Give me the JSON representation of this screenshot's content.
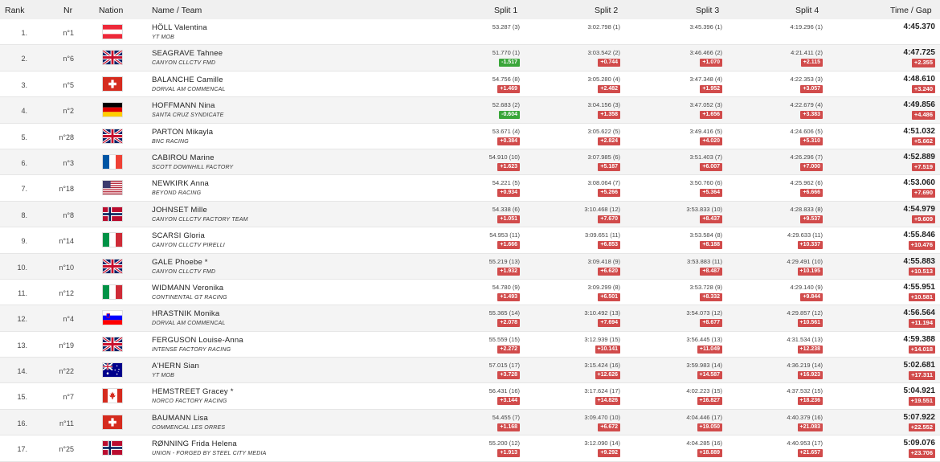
{
  "headers": {
    "rank": "Rank",
    "nr": "Nr",
    "nation": "Nation",
    "name_team": "Name / Team",
    "split1": "Split 1",
    "split2": "Split 2",
    "split3": "Split 3",
    "split4": "Split 4",
    "time_gap": "Time / Gap"
  },
  "rows": [
    {
      "rank": "1.",
      "nr": "n°1",
      "flag": "AUT",
      "name": "HÖLL Valentina",
      "team": "YT MOB",
      "s1": "53.287 (3)",
      "s1g": "",
      "s2": "3:02.798 (1)",
      "s2g": "",
      "s3": "3:45.396 (1)",
      "s3g": "",
      "s4": "4:19.296 (1)",
      "s4g": "",
      "time": "4:45.370",
      "gap": ""
    },
    {
      "rank": "2.",
      "nr": "n°6",
      "flag": "GBR",
      "name": "SEAGRAVE Tahnee",
      "team": "CANYON CLLCTV FMD",
      "s1": "51.770 (1)",
      "s1g": "-1.517",
      "s2": "3:03.542 (2)",
      "s2g": "+0.744",
      "s3": "3:46.466 (2)",
      "s3g": "+1.070",
      "s4": "4:21.411 (2)",
      "s4g": "+2.115",
      "time": "4:47.725",
      "gap": "+2.355"
    },
    {
      "rank": "3.",
      "nr": "n°5",
      "flag": "SUI",
      "name": "BALANCHE Camille",
      "team": "DORVAL AM COMMENCAL",
      "s1": "54.756 (8)",
      "s1g": "+1.469",
      "s2": "3:05.280 (4)",
      "s2g": "+2.482",
      "s3": "3:47.348 (4)",
      "s3g": "+1.952",
      "s4": "4:22.353 (3)",
      "s4g": "+3.057",
      "time": "4:48.610",
      "gap": "+3.240"
    },
    {
      "rank": "4.",
      "nr": "n°2",
      "flag": "GER",
      "name": "HOFFMANN Nina",
      "team": "SANTA CRUZ SYNDICATE",
      "s1": "52.683 (2)",
      "s1g": "-0.604",
      "s2": "3:04.156 (3)",
      "s2g": "+1.358",
      "s3": "3:47.052 (3)",
      "s3g": "+1.656",
      "s4": "4:22.679 (4)",
      "s4g": "+3.383",
      "time": "4:49.856",
      "gap": "+4.486"
    },
    {
      "rank": "5.",
      "nr": "n°28",
      "flag": "GBR",
      "name": "PARTON Mikayla",
      "team": "BNC RACING",
      "s1": "53.671 (4)",
      "s1g": "+0.384",
      "s2": "3:05.622 (5)",
      "s2g": "+2.824",
      "s3": "3:49.416 (5)",
      "s3g": "+4.020",
      "s4": "4:24.606 (5)",
      "s4g": "+5.310",
      "time": "4:51.032",
      "gap": "+5.662"
    },
    {
      "rank": "6.",
      "nr": "n°3",
      "flag": "FRA",
      "name": "CABIROU Marine",
      "team": "SCOTT DOWNHILL FACTORY",
      "s1": "54.910 (10)",
      "s1g": "+1.623",
      "s2": "3:07.985 (6)",
      "s2g": "+5.187",
      "s3": "3:51.403 (7)",
      "s3g": "+6.007",
      "s4": "4:26.296 (7)",
      "s4g": "+7.000",
      "time": "4:52.889",
      "gap": "+7.519"
    },
    {
      "rank": "7.",
      "nr": "n°18",
      "flag": "USA",
      "name": "NEWKIRK Anna",
      "team": "BEYOND RACING",
      "s1": "54.221 (5)",
      "s1g": "+0.934",
      "s2": "3:08.064 (7)",
      "s2g": "+5.266",
      "s3": "3:50.760 (6)",
      "s3g": "+5.364",
      "s4": "4:25.962 (6)",
      "s4g": "+6.666",
      "time": "4:53.060",
      "gap": "+7.690"
    },
    {
      "rank": "8.",
      "nr": "n°8",
      "flag": "NOR",
      "name": "JOHNSET Mille",
      "team": "CANYON CLLCTV FACTORY TEAM",
      "s1": "54.338 (6)",
      "s1g": "+1.051",
      "s2": "3:10.468 (12)",
      "s2g": "+7.670",
      "s3": "3:53.833 (10)",
      "s3g": "+8.437",
      "s4": "4:28.833 (8)",
      "s4g": "+9.537",
      "time": "4:54.979",
      "gap": "+9.609"
    },
    {
      "rank": "9.",
      "nr": "n°14",
      "flag": "ITA",
      "name": "SCARSI Gloria",
      "team": "CANYON CLLCTV PIRELLI",
      "s1": "54.953 (11)",
      "s1g": "+1.666",
      "s2": "3:09.651 (11)",
      "s2g": "+6.853",
      "s3": "3:53.584 (8)",
      "s3g": "+8.188",
      "s4": "4:29.633 (11)",
      "s4g": "+10.337",
      "time": "4:55.846",
      "gap": "+10.476"
    },
    {
      "rank": "10.",
      "nr": "n°10",
      "flag": "GBR",
      "name": "GALE Phoebe *",
      "team": "CANYON CLLCTV FMD",
      "s1": "55.219 (13)",
      "s1g": "+1.932",
      "s2": "3:09.418 (9)",
      "s2g": "+6.620",
      "s3": "3:53.883 (11)",
      "s3g": "+8.487",
      "s4": "4:29.491 (10)",
      "s4g": "+10.195",
      "time": "4:55.883",
      "gap": "+10.513"
    },
    {
      "rank": "11.",
      "nr": "n°12",
      "flag": "ITA",
      "name": "WIDMANN Veronika",
      "team": "CONTINENTAL GT RACING",
      "s1": "54.780 (9)",
      "s1g": "+1.493",
      "s2": "3:09.299 (8)",
      "s2g": "+6.501",
      "s3": "3:53.728 (9)",
      "s3g": "+8.332",
      "s4": "4:29.140 (9)",
      "s4g": "+9.844",
      "time": "4:55.951",
      "gap": "+10.581"
    },
    {
      "rank": "12.",
      "nr": "n°4",
      "flag": "SLO",
      "name": "HRASTNIK Monika",
      "team": "DORVAL AM COMMENCAL",
      "s1": "55.365 (14)",
      "s1g": "+2.078",
      "s2": "3:10.492 (13)",
      "s2g": "+7.694",
      "s3": "3:54.073 (12)",
      "s3g": "+8.677",
      "s4": "4:29.857 (12)",
      "s4g": "+10.561",
      "time": "4:56.564",
      "gap": "+11.194"
    },
    {
      "rank": "13.",
      "nr": "n°19",
      "flag": "GBR",
      "name": "FERGUSON Louise-Anna",
      "team": "INTENSE FACTORY RACING",
      "s1": "55.559 (15)",
      "s1g": "+2.272",
      "s2": "3:12.939 (15)",
      "s2g": "+10.141",
      "s3": "3:56.445 (13)",
      "s3g": "+11.049",
      "s4": "4:31.534 (13)",
      "s4g": "+12.238",
      "time": "4:59.388",
      "gap": "+14.018"
    },
    {
      "rank": "14.",
      "nr": "n°22",
      "flag": "AUS",
      "name": "A'HERN Sian",
      "team": "YT MOB",
      "s1": "57.015 (17)",
      "s1g": "+3.728",
      "s2": "3:15.424 (16)",
      "s2g": "+12.626",
      "s3": "3:59.983 (14)",
      "s3g": "+14.587",
      "s4": "4:36.219 (14)",
      "s4g": "+16.923",
      "time": "5:02.681",
      "gap": "+17.311"
    },
    {
      "rank": "15.",
      "nr": "n°7",
      "flag": "CAN",
      "name": "HEMSTREET Gracey *",
      "team": "NORCO FACTORY RACING",
      "s1": "56.431 (16)",
      "s1g": "+3.144",
      "s2": "3:17.624 (17)",
      "s2g": "+14.826",
      "s3": "4:02.223 (15)",
      "s3g": "+16.827",
      "s4": "4:37.532 (15)",
      "s4g": "+18.236",
      "time": "5:04.921",
      "gap": "+19.551"
    },
    {
      "rank": "16.",
      "nr": "n°11",
      "flag": "SUI",
      "name": "BAUMANN Lisa",
      "team": "COMMENCAL LES ORRES",
      "s1": "54.455 (7)",
      "s1g": "+1.168",
      "s2": "3:09.470 (10)",
      "s2g": "+6.672",
      "s3": "4:04.446 (17)",
      "s3g": "+19.050",
      "s4": "4:40.379 (16)",
      "s4g": "+21.083",
      "time": "5:07.922",
      "gap": "+22.552"
    },
    {
      "rank": "17.",
      "nr": "n°25",
      "flag": "NOR",
      "name": "RØNNING Frida Helena",
      "team": "UNION - FORGED BY STEEL CITY MEDIA",
      "s1": "55.200 (12)",
      "s1g": "+1.913",
      "s2": "3:12.090 (14)",
      "s2g": "+9.292",
      "s3": "4:04.285 (16)",
      "s3g": "+18.889",
      "s4": "4:40.953 (17)",
      "s4g": "+21.657",
      "time": "5:09.076",
      "gap": "+23.706"
    }
  ]
}
